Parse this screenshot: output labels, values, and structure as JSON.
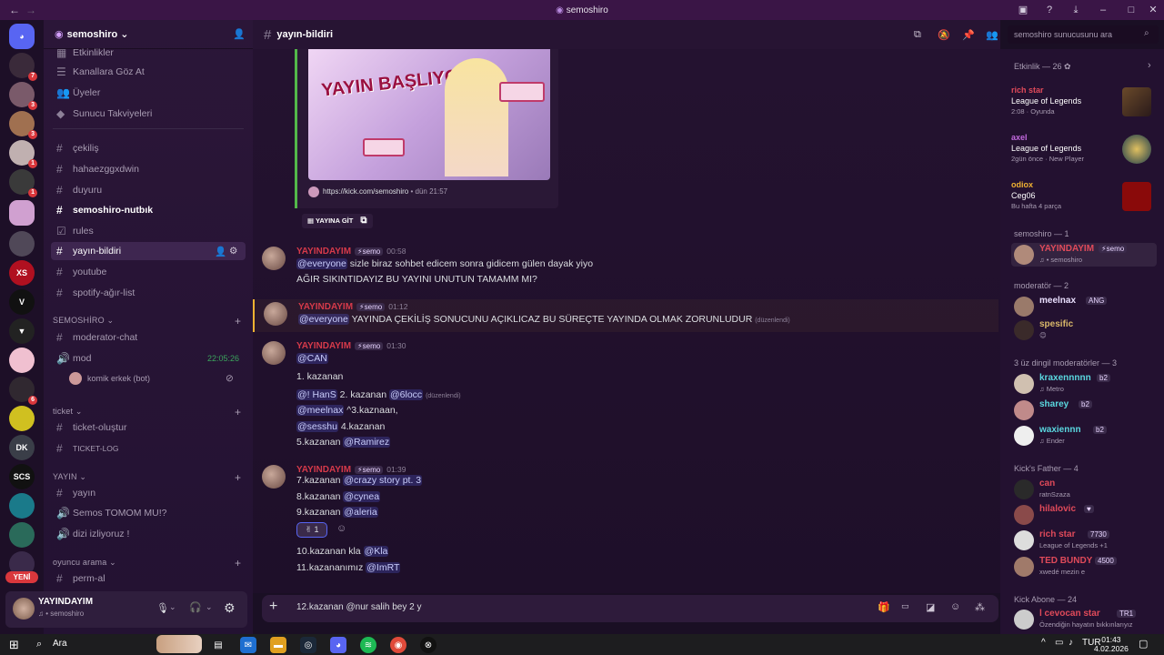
{
  "window": {
    "title": "semoshiro",
    "nav_back": "←",
    "nav_fwd": "→"
  },
  "server": {
    "name": "semoshiro",
    "search_placeholder": "semoshiro sunucusunu ara"
  },
  "guild_badges": [
    "7",
    "3",
    "3",
    "1",
    "1",
    "6"
  ],
  "guild_labels": {
    "dk": "DK",
    "xs": "XS",
    "scs": "SCS",
    "new": "YENİ"
  },
  "channels": {
    "top": [
      "Etkinlikler",
      "Kanallara Göz At",
      "Üyeler",
      "Sunucu Takviyeleri"
    ],
    "text": [
      "çekiliş",
      "hahaezggxdwin",
      "duyuru",
      "semoshiro-nutbık",
      "rules",
      "yayın-bildiri",
      "youtube",
      "spotify-ağır-list"
    ],
    "cat_semoshiro": "SEMOSHİRO",
    "semoshiro": [
      "moderator-chat",
      "mod"
    ],
    "mod_timer": "22:05:26",
    "bot_user": "komik erkek (bot)",
    "cat_ticket": "ticket",
    "ticket": [
      "ticket-oluştur",
      "TICKET-LOG"
    ],
    "cat_yayin": "YAYIN",
    "yayin": [
      "yayın",
      "Semos TOMOM MU!?",
      "dizi izliyoruz !"
    ],
    "cat_oyuncu": "oyuncu arama",
    "oyuncu": [
      "perm-al"
    ]
  },
  "user_panel": {
    "name": "YAYINDAYIM",
    "status": "♫ • semoshiro"
  },
  "chat": {
    "channel": "yayın-bildiri",
    "embed_link": "https://kick.com/semoshiro",
    "embed_time": "• dün 21:57",
    "embed_banner": "YAYIN BAŞLIYOR",
    "go_button": "YAYINA GİT",
    "author": "YAYINDAYIM",
    "author_tag": "⚡semo",
    "messages": [
      {
        "time": "00:58",
        "lines": [
          "@everyone sizle biraz sohbet edicem sonra gidicem gülen dayak yiyo",
          "AĞIR SIKINTIDAYIZ BU YAYINI UNUTUN TAMAMM MI?"
        ]
      },
      {
        "time": "01:12",
        "lines": [
          "@everyone YAYINDA ÇEKİLİŞ SONUCUNU AÇIKLICAZ BU SÜREÇTE YAYINDA OLMAK ZORUNLUDUR"
        ]
      },
      {
        "time": "01:30",
        "lines": [
          "@CAN",
          "1. kazanan",
          "@! HanS 2. kazanan @6locc",
          "@meelnax ^3.kaznaan,",
          "@sesshu 4.kazanan",
          "5.kazanan @Ramirez"
        ]
      },
      {
        "time": "01:39",
        "lines": [
          "7.kazanan @crazy story pt. 3",
          "8.kazanan @cynea",
          "9.kazanan @aleria",
          "10.kazanan kla @Kla",
          "11.kazananımız @ImRT"
        ]
      }
    ],
    "edited": "(düzenlendi)",
    "reaction": {
      "emoji": "✌",
      "count": "1"
    },
    "composer_text": "12.kazanan @nur salih bey 2 y"
  },
  "members": {
    "activity_header": "Etkinlik — 26 ✿",
    "activities": [
      {
        "name": "rich star",
        "game": "League of Legends",
        "detail": "2:08 · Oyunda"
      },
      {
        "name": "axel",
        "game": "League of Legends",
        "detail": "2gün önce · New Player"
      },
      {
        "name": "odiox",
        "game": "Ceg06",
        "detail": "Bu hafta 4 parça"
      }
    ],
    "groups": [
      {
        "header": "semoshiro — 1",
        "items": [
          {
            "name": "YAYINDAYIM",
            "tag": "⚡semo",
            "sub": "♫ • semoshiro",
            "color": "#e04a5a"
          }
        ]
      },
      {
        "header": "moderatör — 2",
        "items": [
          {
            "name": "meelnax",
            "tag": "ANG",
            "sub": "",
            "color": "#eae0ff"
          },
          {
            "name": "spesific",
            "tag": "",
            "sub": "😊",
            "color": "#d9b86a"
          }
        ]
      },
      {
        "header": "3 üz dingil moderatörler — 3",
        "items": [
          {
            "name": "kraxennnnn",
            "tag": "b2",
            "sub": "♫ Metro",
            "color": "#5ad8e0"
          },
          {
            "name": "sharey",
            "tag": "b2",
            "sub": "",
            "color": "#5ad8e0"
          },
          {
            "name": "waxiennn",
            "tag": "b2",
            "sub": "♫ Ender",
            "color": "#5ad8e0"
          }
        ]
      },
      {
        "header": "Kick's Father — 4",
        "items": [
          {
            "name": "can",
            "tag": "",
            "sub": "ratnSzaza",
            "color": "#e04a5a"
          },
          {
            "name": "hilalovic",
            "tag": "♥",
            "sub": "",
            "color": "#e04a5a"
          },
          {
            "name": "rich star",
            "tag": "7730",
            "sub": "League of Legends +1",
            "color": "#e04a5a"
          },
          {
            "name": "TED BUNDY",
            "tag": "4500",
            "sub": "xwedé mezin e",
            "color": "#e04a5a"
          }
        ]
      },
      {
        "header": "Kick Abone — 24",
        "items": [
          {
            "name": "l cevocan star",
            "tag": "TR1",
            "sub": "Özendiğin hayatın bıkkınlarıyız",
            "color": "#e04a5a"
          }
        ]
      }
    ]
  },
  "taskbar": {
    "search": "Ara",
    "time": "01:43",
    "date": "4.02.2026",
    "lang": "TUR"
  },
  "colors": {
    "accent": "#5865f2",
    "danger": "#da373c",
    "mention": "#c9cdfb",
    "embed_border": "#53b84a"
  }
}
